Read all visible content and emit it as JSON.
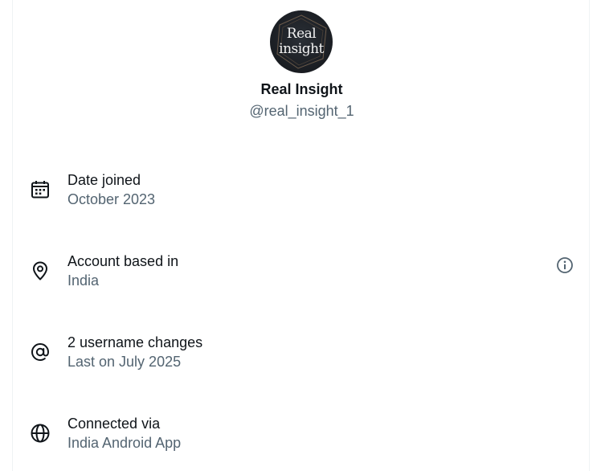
{
  "profile": {
    "avatar_text_line1": "Real",
    "avatar_text_line2": "insight",
    "display_name": "Real Insight",
    "handle": "@real_insight_1"
  },
  "details": [
    {
      "icon": "calendar-icon",
      "title": "Date joined",
      "value": "October 2023"
    },
    {
      "icon": "location-pin-icon",
      "title": "Account based in",
      "value": "India",
      "extra_icon": "info-icon"
    },
    {
      "icon": "at-sign-icon",
      "title": "2 username changes",
      "value": "Last on July 2025"
    },
    {
      "icon": "globe-icon",
      "title": "Connected via",
      "value": "India Android App"
    }
  ],
  "colors": {
    "primary_text": "#0f1419",
    "secondary_text": "#536471",
    "border": "#eff3f4"
  }
}
